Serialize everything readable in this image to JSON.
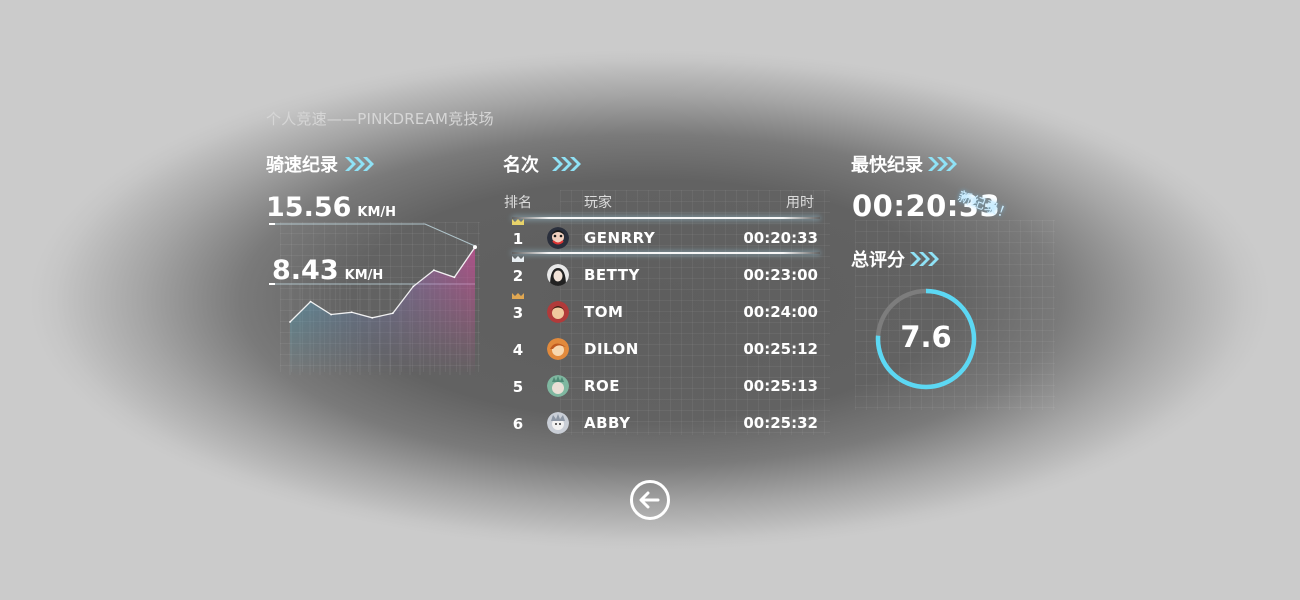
{
  "header": {
    "subtitle": "个人竞速——PINKDREAM竞技场"
  },
  "speed_panel": {
    "title": "骑速纪录",
    "max_speed": "15.56",
    "max_unit": "KM/H",
    "avg_speed": "8.43",
    "avg_unit": "KM/H"
  },
  "chart_data": {
    "type": "area",
    "series": [
      {
        "values": [
          0.0,
          0.63,
          0.23,
          0.3,
          0.13,
          0.27,
          1.1,
          1.6,
          1.38,
          2.31
        ]
      }
    ],
    "reference_lines": [
      {
        "label": "15.56",
        "unit": "KM/H"
      },
      {
        "label": "8.43",
        "unit": "KM/H"
      }
    ],
    "grid": true,
    "colors": {
      "low": "#46aac8",
      "high": "#d24b9b",
      "line": "#ffffff"
    }
  },
  "ranking": {
    "title": "名次",
    "columns": {
      "rank": "排名",
      "player": "玩家",
      "time": "用时"
    },
    "rows": [
      {
        "rank": "1",
        "name": "GENRRY",
        "time": "00:20:33",
        "crown": "gold"
      },
      {
        "rank": "2",
        "name": "BETTY",
        "time": "00:23:00",
        "crown": "silver"
      },
      {
        "rank": "3",
        "name": "TOM",
        "time": "00:24:00",
        "crown": "bronze"
      },
      {
        "rank": "4",
        "name": "DILON",
        "time": "00:25:12",
        "crown": ""
      },
      {
        "rank": "5",
        "name": "ROE",
        "time": "00:25:13",
        "crown": ""
      },
      {
        "rank": "6",
        "name": "ABBY",
        "time": "00:25:32",
        "crown": ""
      }
    ]
  },
  "best_record": {
    "title": "最快纪录",
    "time": "00:20:33",
    "badge": "新纪录！"
  },
  "score": {
    "title": "总评分",
    "value": "7.6",
    "fraction": 0.76,
    "ring_color": "#5cd8f4"
  },
  "controls": {
    "back_icon": "back-arrow-circle-icon"
  },
  "colors": {
    "accent": "#7fdcf0",
    "text": "#ffffff",
    "crown_gold": "#e8d36a",
    "crown_silver": "#e8eef2",
    "crown_bronze": "#e0a752"
  }
}
